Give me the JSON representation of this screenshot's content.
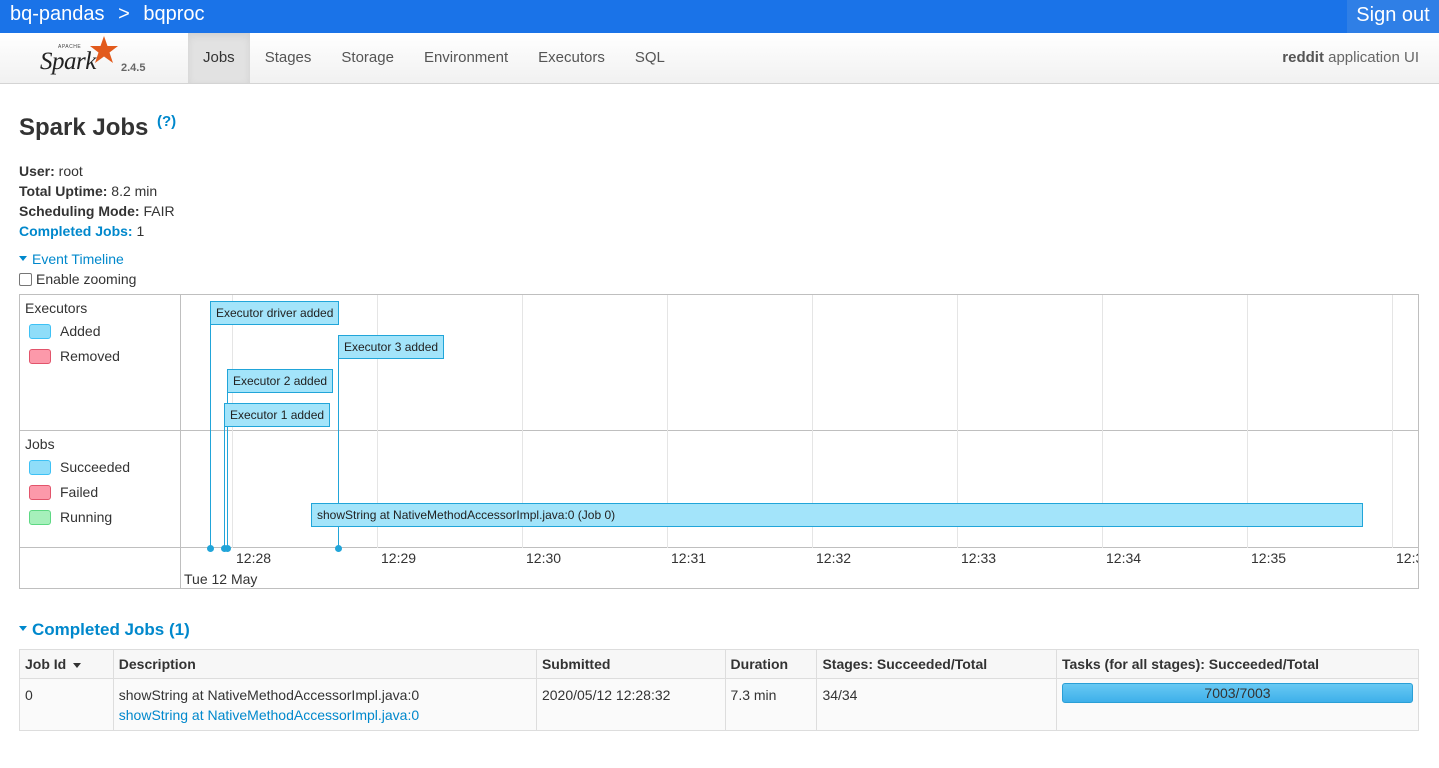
{
  "topbar": {
    "crumbs": [
      "bq-pandas",
      ">",
      "bqproc"
    ],
    "sign_out": "Sign out"
  },
  "nav": {
    "logo": {
      "word": "Spark",
      "apache": "APACHE",
      "version": "2.4.5"
    },
    "tabs": [
      {
        "label": "Jobs",
        "active": true
      },
      {
        "label": "Stages"
      },
      {
        "label": "Storage"
      },
      {
        "label": "Environment"
      },
      {
        "label": "Executors"
      },
      {
        "label": "SQL"
      }
    ],
    "app_name_bold": "reddit",
    "app_name_rest": " application UI"
  },
  "page": {
    "title": "Spark Jobs",
    "help": "(?)",
    "summary": {
      "user_label": "User:",
      "user": " root",
      "uptime_label": "Total Uptime:",
      "uptime": " 8.2 min",
      "sched_label": "Scheduling Mode:",
      "sched": " FAIR",
      "completed_label": "Completed Jobs:",
      "completed": " 1"
    },
    "event_timeline": "Event Timeline",
    "enable_zooming": "Enable zooming"
  },
  "timeline": {
    "executors_title": "Executors",
    "executors_legend": [
      "Added",
      "Removed"
    ],
    "jobs_title": "Jobs",
    "jobs_legend": [
      "Succeeded",
      "Failed",
      "Running"
    ],
    "executor_events": [
      "Executor driver added",
      "Executor 3 added",
      "Executor 2 added",
      "Executor 1 added"
    ],
    "job_bar": "showString at NativeMethodAccessorImpl.java:0 (Job 0)",
    "axis_ticks": [
      "12:28",
      "12:29",
      "12:30",
      "12:31",
      "12:32",
      "12:33",
      "12:34",
      "12:35",
      "12:3"
    ],
    "axis_date": "Tue 12 May"
  },
  "completed_jobs": {
    "title": "Completed Jobs (1)",
    "columns": [
      "Job Id",
      "Description",
      "Submitted",
      "Duration",
      "Stages: Succeeded/Total",
      "Tasks (for all stages): Succeeded/Total"
    ],
    "rows": [
      {
        "job_id": "0",
        "description": "showString at NativeMethodAccessorImpl.java:0",
        "description_link": "showString at NativeMethodAccessorImpl.java:0",
        "submitted": "2020/05/12 12:28:32",
        "duration": "7.3 min",
        "stages": "34/34",
        "tasks": "7003/7003",
        "tasks_progress": 1.0
      }
    ]
  }
}
